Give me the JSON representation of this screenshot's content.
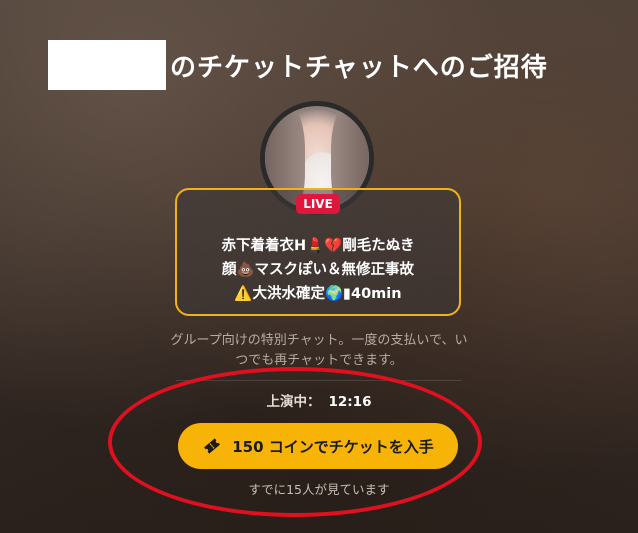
{
  "header": {
    "title": "のチケットチャットへのご招待"
  },
  "live_badge": "LIVE",
  "description": {
    "line1": "赤下着着衣H💄💔剛毛たぬき",
    "line2": "顔💩マスクぽい＆無修正事故",
    "line3": "⚠️大洪水確定🌍▮40min"
  },
  "subtext": "グループ向けの特別チャット。一度の支払いで、いつでも再チャットできます。",
  "showtime": {
    "label": "上演中：",
    "value": "12:16"
  },
  "cta": {
    "label": "150 コインでチケットを入手"
  },
  "viewers": "すでに15人が見ています",
  "colors": {
    "accent": "#f7b306",
    "live": "#e0173c",
    "box_border": "#f0b21a",
    "annotation": "#e01020"
  }
}
